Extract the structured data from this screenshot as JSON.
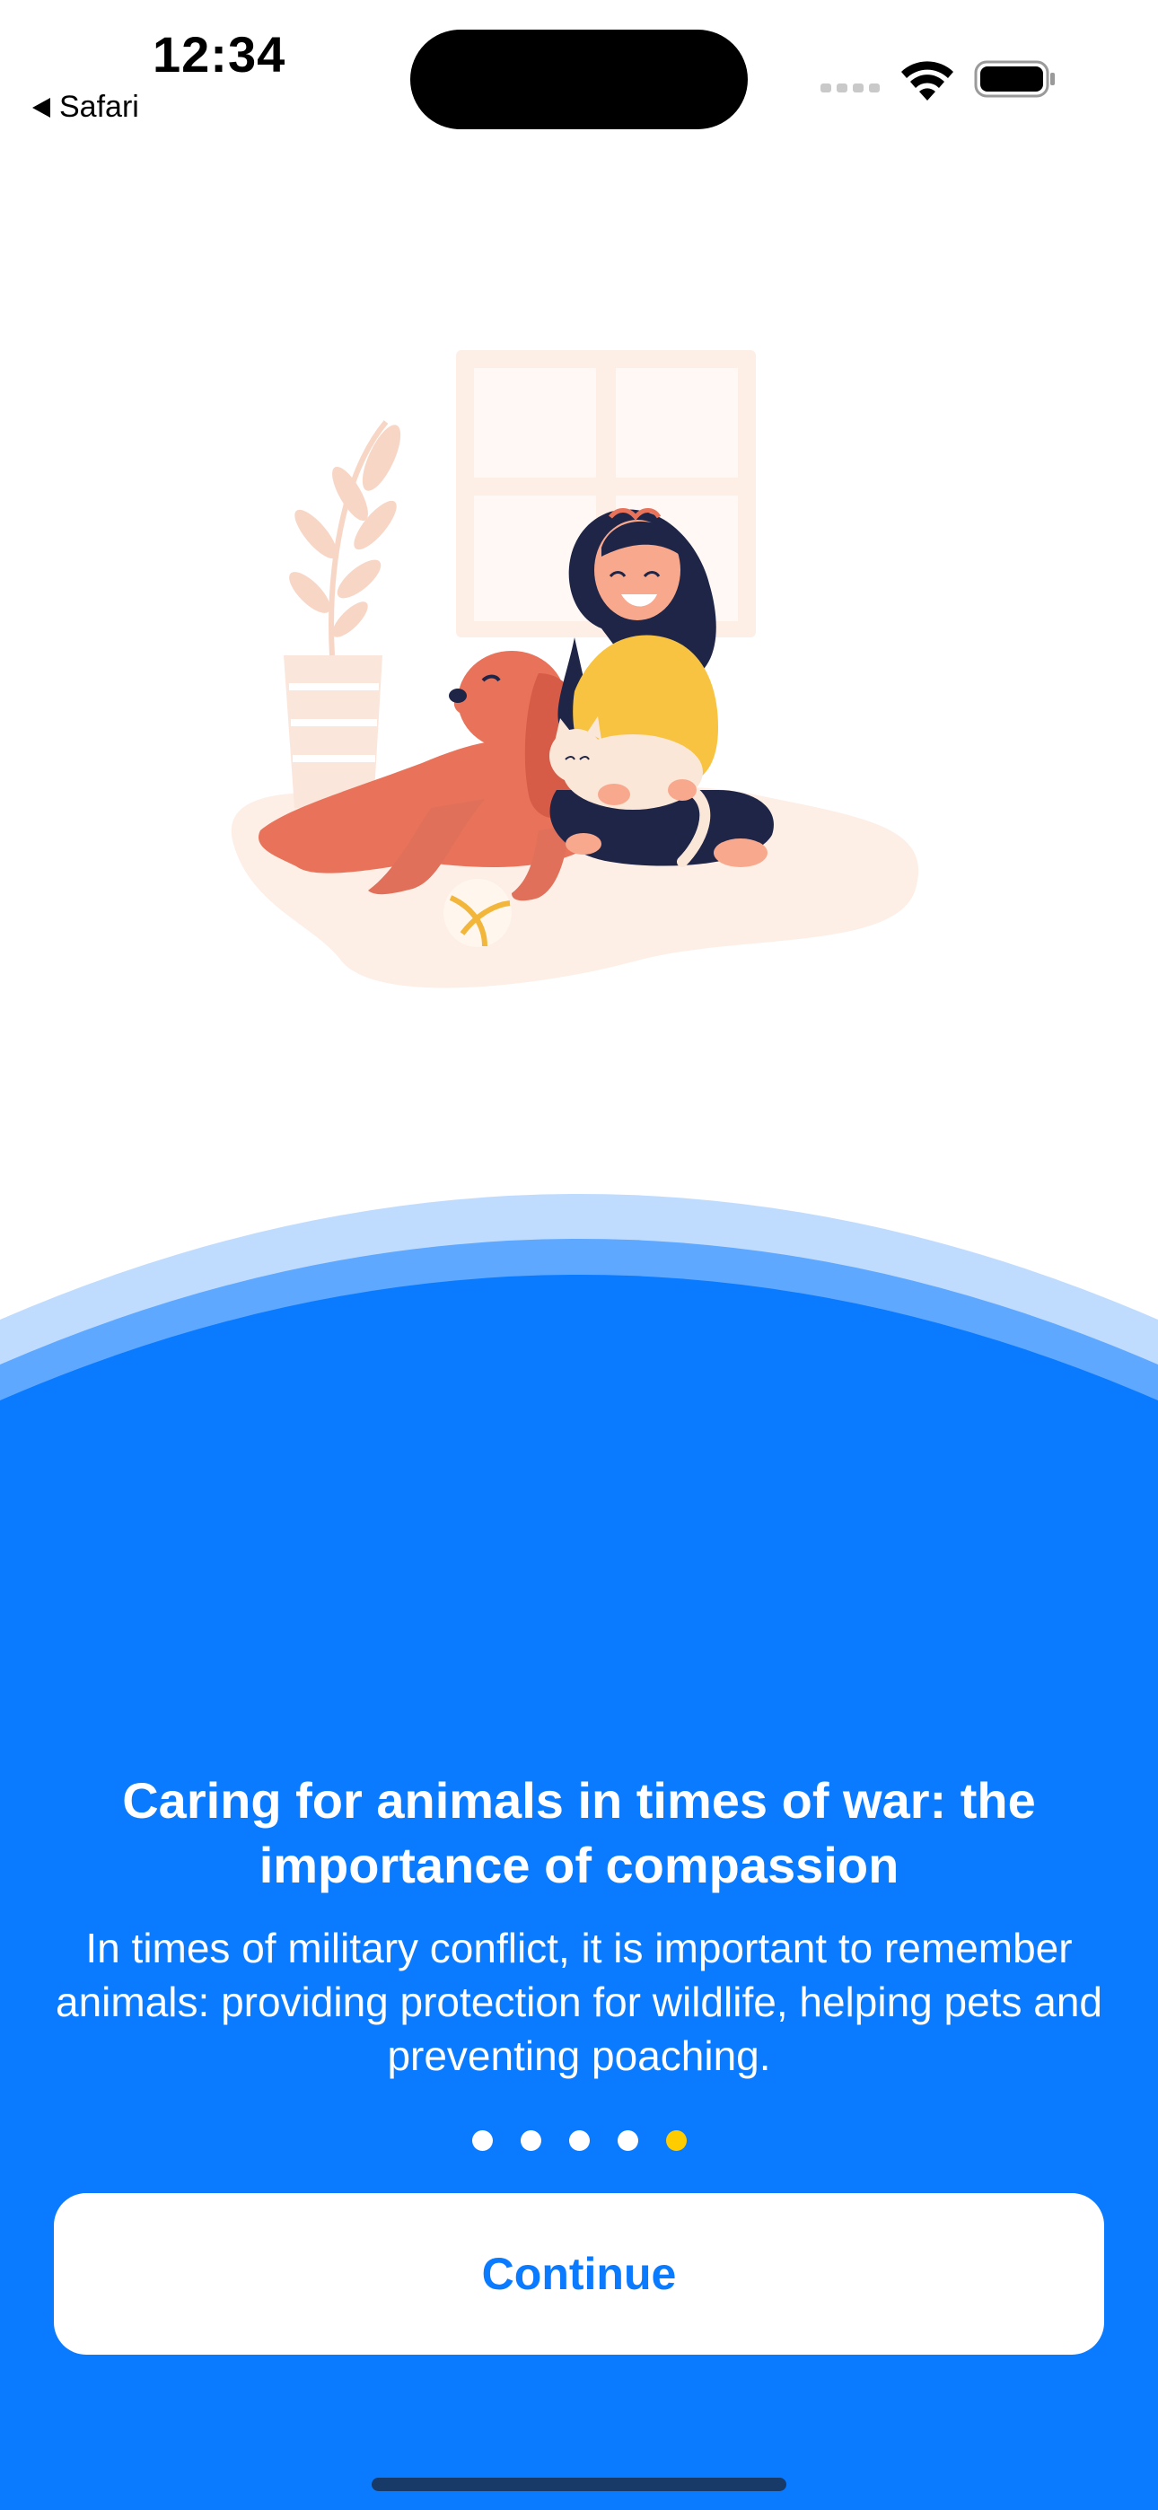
{
  "status_bar": {
    "time": "12:34",
    "back_label": "Safari",
    "icons": [
      "cellular-signal-icon",
      "wifi-icon",
      "battery-icon"
    ]
  },
  "illustration": {
    "icon": "woman-with-dog-and-cat-illustration"
  },
  "onboarding": {
    "title": "Caring for animals in times of war: the importance of compassion",
    "description": "In times of military conflict, it is important to remember animals: providing protection for wildlife, helping pets and preventing poaching.",
    "page_count": 5,
    "current_page": 5,
    "continue_label": "Continue"
  },
  "colors": {
    "primary_blue": "#0a7aff",
    "mid_blue": "#5ea8ff",
    "light_blue": "#bfdcff",
    "active_dot": "#ffcc00",
    "background": "#ffffff"
  }
}
